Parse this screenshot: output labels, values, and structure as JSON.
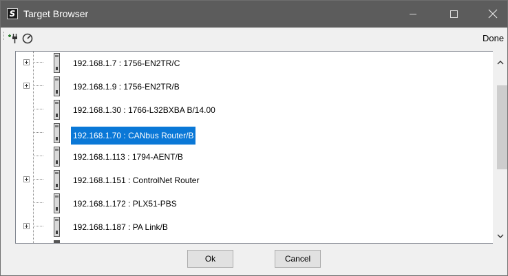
{
  "window": {
    "title": "Target Browser",
    "app_icon_letter": "S",
    "controls": [
      "minimize",
      "maximize",
      "close"
    ]
  },
  "toolbar": {
    "icons": [
      "connect-icon",
      "refresh-icon"
    ],
    "done_label": "Done"
  },
  "tree": {
    "items": [
      {
        "label": "192.168.1.7 : 1756-EN2TR/C",
        "expandable": true,
        "selected": false
      },
      {
        "label": "192.168.1.9 : 1756-EN2TR/B",
        "expandable": true,
        "selected": false
      },
      {
        "label": "192.168.1.30 : 1766-L32BXBA B/14.00",
        "expandable": false,
        "selected": false
      },
      {
        "label": "192.168.1.70 : CANbus Router/B",
        "expandable": false,
        "selected": true
      },
      {
        "label": "192.168.1.113 : 1794-AENT/B",
        "expandable": false,
        "selected": false
      },
      {
        "label": "192.168.1.151 : ControlNet Router",
        "expandable": true,
        "selected": false
      },
      {
        "label": "192.168.1.172 : PLX51-PBS",
        "expandable": false,
        "selected": false
      },
      {
        "label": "192.168.1.187 : PA Link/B",
        "expandable": true,
        "selected": false
      }
    ]
  },
  "buttons": {
    "ok": "Ok",
    "cancel": "Cancel"
  },
  "colors": {
    "titlebar": "#5c5c5c",
    "selection": "#0a78d7",
    "scroll_thumb": "#cdcdcd"
  }
}
